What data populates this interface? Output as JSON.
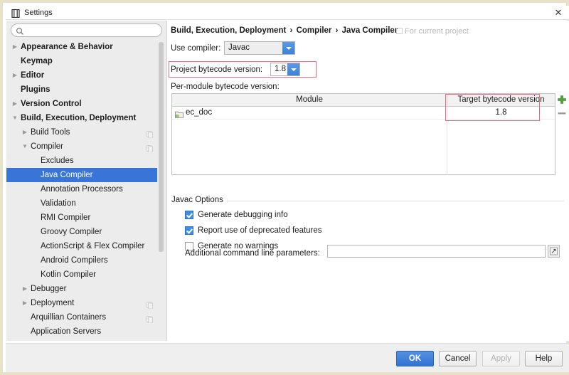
{
  "window": {
    "title": "Settings",
    "icon": "settings-window-icon",
    "close_label": "✕"
  },
  "sidebar": {
    "search": {
      "value": "",
      "placeholder": "",
      "icon": "search-icon"
    },
    "items": [
      {
        "label": "Appearance & Behavior",
        "indent": 0,
        "twisty": "collapsed",
        "bold": true,
        "selected": false,
        "config_icon": false
      },
      {
        "label": "Keymap",
        "indent": 0,
        "twisty": "none",
        "bold": true,
        "selected": false,
        "config_icon": false
      },
      {
        "label": "Editor",
        "indent": 0,
        "twisty": "collapsed",
        "bold": true,
        "selected": false,
        "config_icon": false
      },
      {
        "label": "Plugins",
        "indent": 0,
        "twisty": "none",
        "bold": true,
        "selected": false,
        "config_icon": false
      },
      {
        "label": "Version Control",
        "indent": 0,
        "twisty": "collapsed",
        "bold": true,
        "selected": false,
        "config_icon": false
      },
      {
        "label": "Build, Execution, Deployment",
        "indent": 0,
        "twisty": "expanded",
        "bold": true,
        "selected": false,
        "config_icon": false
      },
      {
        "label": "Build Tools",
        "indent": 1,
        "twisty": "collapsed",
        "bold": false,
        "selected": false,
        "config_icon": true
      },
      {
        "label": "Compiler",
        "indent": 1,
        "twisty": "expanded",
        "bold": false,
        "selected": false,
        "config_icon": true
      },
      {
        "label": "Excludes",
        "indent": 2,
        "twisty": "none",
        "bold": false,
        "selected": false,
        "config_icon": false
      },
      {
        "label": "Java Compiler",
        "indent": 2,
        "twisty": "none",
        "bold": false,
        "selected": true,
        "config_icon": false
      },
      {
        "label": "Annotation Processors",
        "indent": 2,
        "twisty": "none",
        "bold": false,
        "selected": false,
        "config_icon": false
      },
      {
        "label": "Validation",
        "indent": 2,
        "twisty": "none",
        "bold": false,
        "selected": false,
        "config_icon": false
      },
      {
        "label": "RMI Compiler",
        "indent": 2,
        "twisty": "none",
        "bold": false,
        "selected": false,
        "config_icon": false
      },
      {
        "label": "Groovy Compiler",
        "indent": 2,
        "twisty": "none",
        "bold": false,
        "selected": false,
        "config_icon": false
      },
      {
        "label": "ActionScript & Flex Compiler",
        "indent": 2,
        "twisty": "none",
        "bold": false,
        "selected": false,
        "config_icon": false
      },
      {
        "label": "Android Compilers",
        "indent": 2,
        "twisty": "none",
        "bold": false,
        "selected": false,
        "config_icon": false
      },
      {
        "label": "Kotlin Compiler",
        "indent": 2,
        "twisty": "none",
        "bold": false,
        "selected": false,
        "config_icon": false
      },
      {
        "label": "Debugger",
        "indent": 1,
        "twisty": "collapsed",
        "bold": false,
        "selected": false,
        "config_icon": false
      },
      {
        "label": "Deployment",
        "indent": 1,
        "twisty": "collapsed",
        "bold": false,
        "selected": false,
        "config_icon": true
      },
      {
        "label": "Arquillian Containers",
        "indent": 1,
        "twisty": "none",
        "bold": false,
        "selected": false,
        "config_icon": true
      },
      {
        "label": "Application Servers",
        "indent": 1,
        "twisty": "none",
        "bold": false,
        "selected": false,
        "config_icon": false
      }
    ]
  },
  "main": {
    "breadcrumb": {
      "parts": [
        "Build, Execution, Deployment",
        "Compiler",
        "Java Compiler"
      ],
      "separator": "›",
      "note": "For current project"
    },
    "use_compiler": {
      "label": "Use compiler:",
      "value": "Javac"
    },
    "project_bytecode": {
      "label": "Project bytecode version:",
      "value": "1.8",
      "highlighted": true
    },
    "per_module": {
      "label": "Per-module bytecode version:",
      "columns": [
        "Module",
        "Target bytecode version"
      ],
      "rows": [
        {
          "module": "ec_doc",
          "target": "1.8"
        }
      ],
      "add_button": "+",
      "remove_button": "−",
      "highlighted_column": "Target bytecode version"
    },
    "javac_options": {
      "title": "Javac Options",
      "checkboxes": [
        {
          "label": "Generate debugging info",
          "checked": true
        },
        {
          "label": "Report use of deprecated features",
          "checked": true
        },
        {
          "label": "Generate no warnings",
          "checked": false
        }
      ],
      "additional_params": {
        "label": "Additional command line parameters:",
        "value": "",
        "placeholder": "",
        "expand_icon": "expand-editor-icon"
      }
    }
  },
  "footer": {
    "buttons": [
      {
        "label": "OK",
        "style": "primary"
      },
      {
        "label": "Cancel",
        "style": "normal"
      },
      {
        "label": "Apply",
        "style": "disabled"
      },
      {
        "label": "Help",
        "style": "normal"
      }
    ]
  },
  "colors": {
    "accent": "#3875d7",
    "selection": "#3875d7",
    "annotation": "#e86a80",
    "window_border": "#e8e2cb"
  }
}
